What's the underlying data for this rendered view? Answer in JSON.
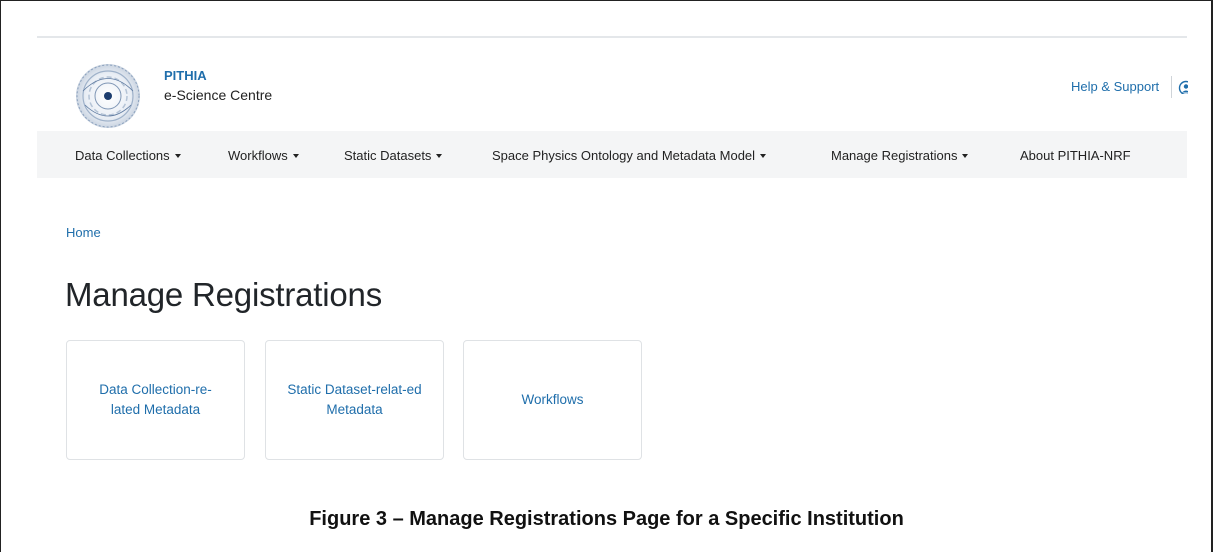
{
  "header": {
    "brand_name": "PITHIA",
    "brand_subtitle": "e-Science Centre",
    "help_link": "Help & Support"
  },
  "nav": {
    "items": [
      {
        "label": "Data Collections",
        "dropdown": true
      },
      {
        "label": "Workflows",
        "dropdown": true
      },
      {
        "label": "Static Datasets",
        "dropdown": true
      },
      {
        "label": "Space Physics Ontology and Metadata Model",
        "dropdown": true
      },
      {
        "label": "Manage Registrations",
        "dropdown": true
      },
      {
        "label": "About PITHIA-NRF",
        "dropdown": false
      }
    ]
  },
  "breadcrumb": {
    "home": "Home"
  },
  "page": {
    "title": "Manage Registrations"
  },
  "cards": [
    {
      "label": "Data Collection-re-lated Metadata"
    },
    {
      "label": "Static Dataset-relat-ed Metadata"
    },
    {
      "label": "Workflows"
    }
  ],
  "caption": "Figure 3 – Manage Registrations Page for a Specific Institution",
  "colors": {
    "link": "#1f6eab",
    "nav_bg": "#f4f5f6",
    "text": "#212529"
  },
  "icons": {
    "logo": "pithia-nrf-logo",
    "user": "user-icon"
  }
}
